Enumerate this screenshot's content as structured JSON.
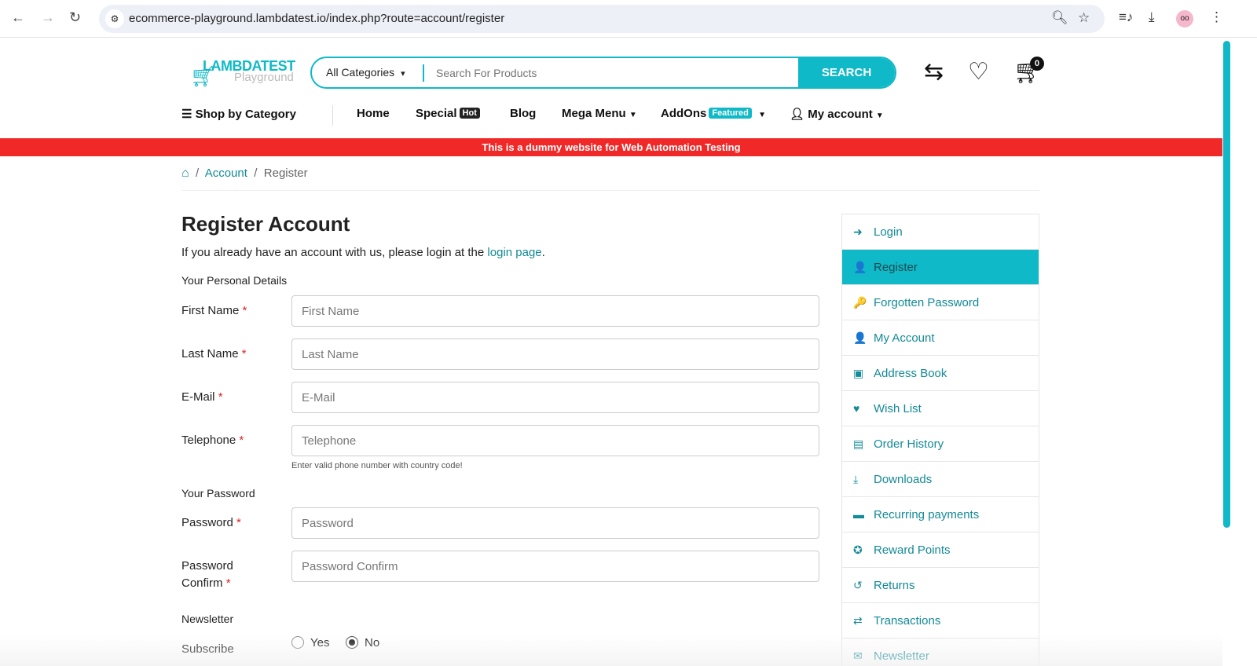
{
  "browser": {
    "url": "ecommerce-playground.lambdatest.io/index.php?route=account/register"
  },
  "header": {
    "logo_main": "LAMBDATEST",
    "logo_sub": "Playground",
    "category_select": "All Categories",
    "search_placeholder": "Search For Products",
    "search_button": "SEARCH",
    "cart_count": "0"
  },
  "nav": {
    "shop_by_category": "Shop by Category",
    "items": [
      {
        "label": "Home"
      },
      {
        "label": "Special",
        "badge": "Hot"
      },
      {
        "label": "Blog"
      },
      {
        "label": "Mega Menu"
      },
      {
        "label": "AddOns",
        "badge": "Featured"
      },
      {
        "label": "My account"
      }
    ]
  },
  "banner": "This is a dummy website for Web Automation Testing",
  "breadcrumb": {
    "sep": "/",
    "account": "Account",
    "current": "Register"
  },
  "form": {
    "title": "Register Account",
    "intro": "If you already have an account with us, please login at the ",
    "intro_link": "login page",
    "intro_end": ".",
    "personal_heading": "Your Personal Details",
    "first_name": {
      "label": "First Name",
      "placeholder": "First Name"
    },
    "last_name": {
      "label": "Last Name",
      "placeholder": "Last Name"
    },
    "email": {
      "label": "E-Mail",
      "placeholder": "E-Mail"
    },
    "telephone": {
      "label": "Telephone",
      "placeholder": "Telephone",
      "help": "Enter valid phone number with country code!"
    },
    "password_heading": "Your Password",
    "password": {
      "label": "Password",
      "placeholder": "Password"
    },
    "confirm": {
      "label": "Password Confirm",
      "placeholder": "Password Confirm"
    },
    "newsletter_heading": "Newsletter",
    "subscribe_label": "Subscribe",
    "yes": "Yes",
    "no": "No",
    "subscribe_value": "No",
    "required_mark": "*"
  },
  "sidebar": [
    {
      "label": "Login",
      "icon": "➜"
    },
    {
      "label": "Register",
      "icon": "👤"
    },
    {
      "label": "Forgotten Password",
      "icon": "🔑"
    },
    {
      "label": "My Account",
      "icon": "👤"
    },
    {
      "label": "Address Book",
      "icon": "▣"
    },
    {
      "label": "Wish List",
      "icon": "♥"
    },
    {
      "label": "Order History",
      "icon": "▤"
    },
    {
      "label": "Downloads",
      "icon": "⤓"
    },
    {
      "label": "Recurring payments",
      "icon": "▬"
    },
    {
      "label": "Reward Points",
      "icon": "✪"
    },
    {
      "label": "Returns",
      "icon": "↺"
    },
    {
      "label": "Transactions",
      "icon": "⇄"
    },
    {
      "label": "Newsletter",
      "icon": "✉"
    }
  ],
  "colors": {
    "accent": "#0fb9c7",
    "link": "#138a97",
    "banner": "#f02828"
  }
}
